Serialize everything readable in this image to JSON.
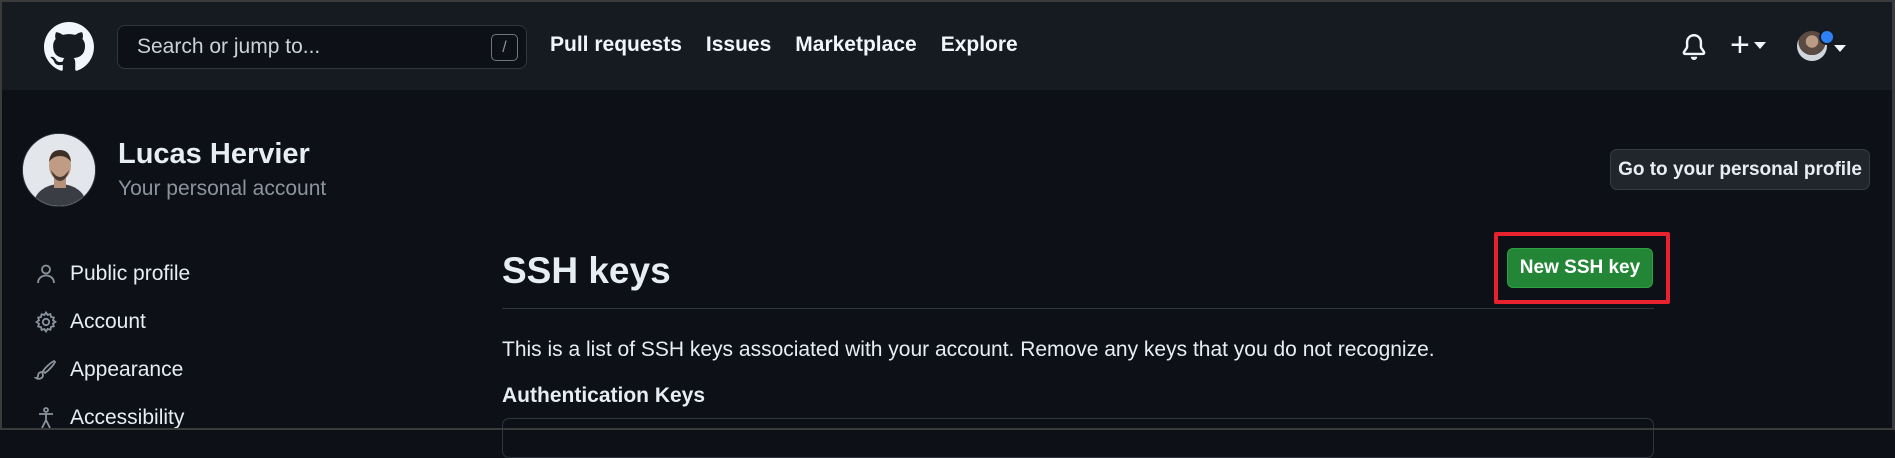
{
  "header": {
    "search_placeholder": "Search or jump to...",
    "search_shortcut": "/",
    "nav": [
      "Pull requests",
      "Issues",
      "Marketplace",
      "Explore"
    ],
    "plus_label": "+"
  },
  "profile": {
    "name": "Lucas Hervier",
    "subtitle": "Your personal account",
    "go_to_profile_label": "Go to your personal profile"
  },
  "sidebar": {
    "items": [
      {
        "label": "Public profile",
        "icon": "person-icon"
      },
      {
        "label": "Account",
        "icon": "gear-icon"
      },
      {
        "label": "Appearance",
        "icon": "paintbrush-icon"
      },
      {
        "label": "Accessibility",
        "icon": "accessibility-icon"
      }
    ]
  },
  "main": {
    "title": "SSH keys",
    "new_key_label": "New SSH key",
    "description": "This is a list of SSH keys associated with your account. Remove any keys that you do not recognize.",
    "auth_keys_title": "Authentication Keys"
  },
  "colors": {
    "background": "#0d1117",
    "header": "#161b22",
    "primary_button": "#238636",
    "highlight_box": "#e8212f",
    "notification_dot": "#2f81f7"
  }
}
